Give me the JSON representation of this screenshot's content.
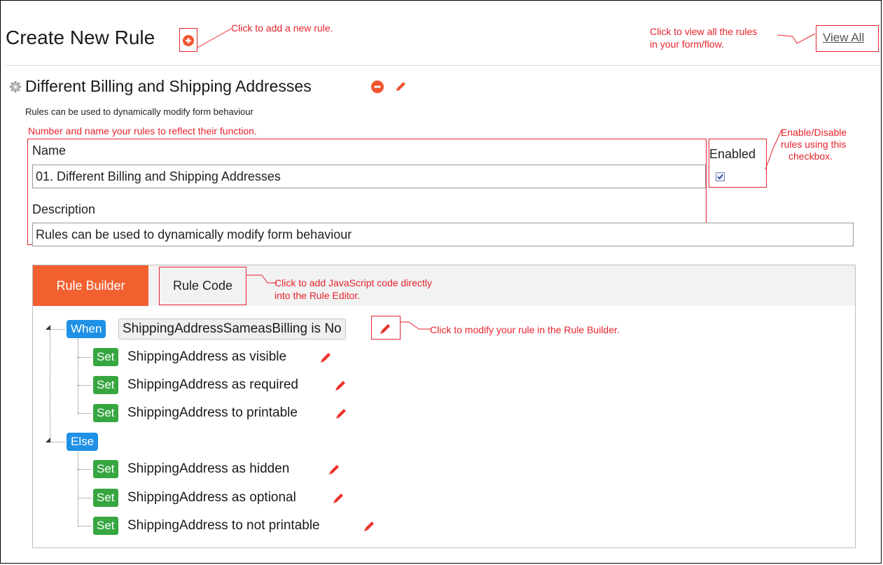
{
  "header": {
    "title": "Create New Rule",
    "view_all": "View All"
  },
  "annotations": {
    "add_rule": "Click to add a new rule.",
    "view_all_line1": "Click to view all the rules",
    "view_all_line2": "in your form/flow.",
    "number_name": "Number and name your rules to reflect their function.",
    "enable_line1": "Enable/Disable",
    "enable_line2": "rules using this",
    "enable_line3": "checkbox.",
    "rule_code_line1": "Click to add JavaScript code directly",
    "rule_code_line2": "into the Rule Editor.",
    "modify_rule": "Click to modify your rule in the Rule Builder."
  },
  "rule": {
    "heading": "Different Billing and Shipping Addresses",
    "subtitle": "Rules can be used to dynamically modify form behaviour",
    "name_label": "Name",
    "name_value": "01. Different Billing and Shipping Addresses",
    "enabled_label": "Enabled",
    "enabled": true,
    "description_label": "Description",
    "description_value": "Rules can be used to dynamically modify form behaviour"
  },
  "tabs": {
    "rule_builder": "Rule Builder",
    "rule_code": "Rule Code"
  },
  "builder": {
    "when_label": "When",
    "condition": "ShippingAddressSameasBilling is No",
    "else_label": "Else",
    "set_label": "Set",
    "when_actions": [
      "ShippingAddress as visible",
      "ShippingAddress as required",
      "ShippingAddress to printable"
    ],
    "else_actions": [
      "ShippingAddress as hidden",
      "ShippingAddress as optional",
      "ShippingAddress to not printable"
    ]
  },
  "colors": {
    "annotation_red": "#e4232d",
    "active_tab": "#f26030",
    "when_else_blue": "#1e90e6",
    "set_green": "#37a641",
    "pencil_red": "#e8322b"
  }
}
